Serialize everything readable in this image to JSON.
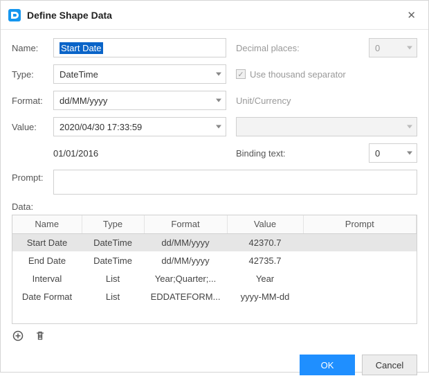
{
  "window": {
    "title": "Define Shape Data"
  },
  "labels": {
    "name": "Name:",
    "type": "Type:",
    "format": "Format:",
    "value": "Value:",
    "prompt": "Prompt:",
    "data": "Data:",
    "decimal_places": "Decimal places:",
    "thousand_sep": "Use thousand separator",
    "unit_currency": "Unit/Currency",
    "binding_text": "Binding text:"
  },
  "fields": {
    "name": "Start Date",
    "type": "DateTime",
    "format": "dd/MM/yyyy",
    "value": "2020/04/30 17:33:59",
    "date_hint": "01/01/2016",
    "decimal_places": "0",
    "binding_text": "0",
    "thousand_sep_checked": true,
    "prompt": ""
  },
  "table": {
    "columns": [
      "Name",
      "Type",
      "Format",
      "Value",
      "Prompt"
    ],
    "rows": [
      {
        "name": "Start Date",
        "type": "DateTime",
        "format": "dd/MM/yyyy",
        "value": "42370.7",
        "prompt": "",
        "selected": true
      },
      {
        "name": "End Date",
        "type": "DateTime",
        "format": "dd/MM/yyyy",
        "value": "42735.7",
        "prompt": "",
        "selected": false
      },
      {
        "name": "Interval",
        "type": "List",
        "format": "Year;Quarter;...",
        "value": "Year",
        "prompt": "",
        "selected": false
      },
      {
        "name": "Date Format",
        "type": "List",
        "format": "EDDATEFORM...",
        "value": "yyyy-MM-dd",
        "prompt": "",
        "selected": false
      }
    ]
  },
  "buttons": {
    "ok": "OK",
    "cancel": "Cancel"
  }
}
